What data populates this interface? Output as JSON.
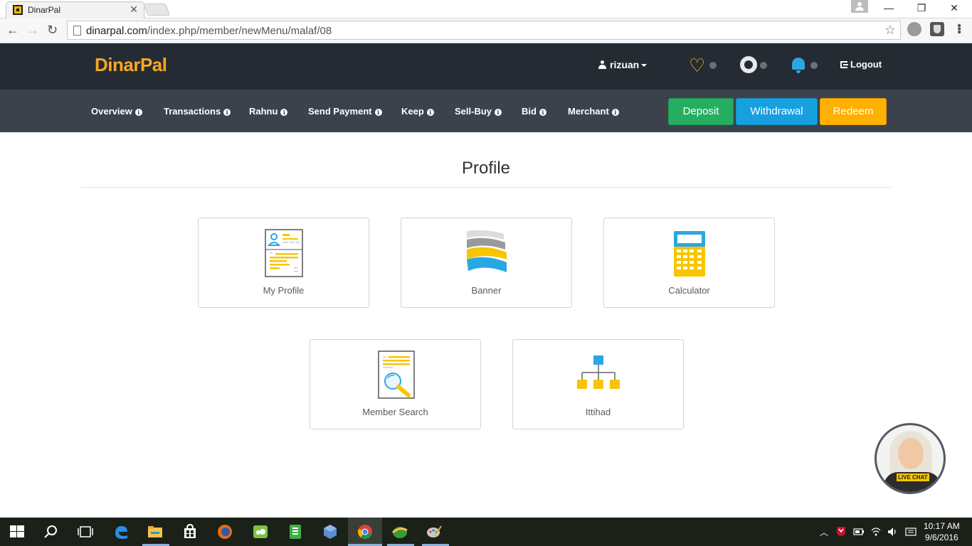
{
  "browser": {
    "tab_title": "DinarPal",
    "tab_close": "✕",
    "url_host": "dinarpal.com",
    "url_path": "/index.php/member/newMenu/malaf/08",
    "back": "←",
    "forward": "→",
    "reload": "↻",
    "star": "☆",
    "minimize": "—",
    "restore": "❐",
    "close": "✕"
  },
  "header": {
    "logo": "DinarPal",
    "username": "rizuan",
    "logout": "Logout"
  },
  "menu": {
    "items": [
      {
        "label": "Overview"
      },
      {
        "label": "Transactions"
      },
      {
        "label": "Rahnu"
      },
      {
        "label": "Send Payment"
      },
      {
        "label": "Keep"
      },
      {
        "label": "Sell-Buy"
      },
      {
        "label": "Bid"
      },
      {
        "label": "Merchant"
      }
    ],
    "info_glyph": "i"
  },
  "actions": {
    "deposit": "Deposit",
    "withdrawal": "Withdrawal",
    "redeem": "Redeem"
  },
  "page": {
    "title": "Profile",
    "cards": [
      {
        "label": "My Profile",
        "icon": "profile-card-icon"
      },
      {
        "label": "Banner",
        "icon": "banner-flag-icon"
      },
      {
        "label": "Calculator",
        "icon": "calculator-icon"
      },
      {
        "label": "Member Search",
        "icon": "member-search-icon"
      },
      {
        "label": "Ittihad",
        "icon": "org-chart-icon"
      }
    ]
  },
  "livechat": {
    "label": "LIVE CHAT"
  },
  "taskbar": {
    "time": "10:17 AM",
    "date": "9/6/2016"
  },
  "colors": {
    "header_bg": "#252b33",
    "menubar_bg": "#3b424b",
    "logo": "#f7a823",
    "deposit": "#26ae60",
    "withdrawal": "#17a0e0",
    "redeem": "#ffb000"
  }
}
